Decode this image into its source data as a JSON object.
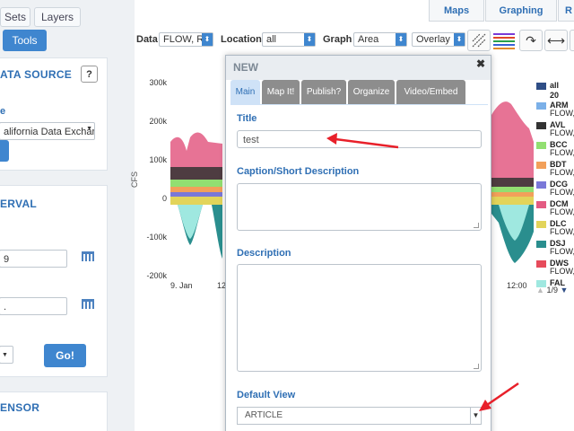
{
  "sidebar": {
    "tabs": [
      {
        "label": "Sets"
      },
      {
        "label": "Layers"
      }
    ],
    "tools_label": "Tools",
    "data_source": {
      "title": "ATA SOURCE",
      "help_label": "?",
      "field_label": "e",
      "source_value": "alifornia Data Exchar"
    },
    "interval": {
      "title": "ERVAL",
      "start_value": "9",
      "end_value": "."
    },
    "go_label": "Go!",
    "sensor_title": "ENSOR"
  },
  "top_tabs": [
    {
      "label": "Maps"
    },
    {
      "label": "Graphing"
    },
    {
      "label": "R"
    }
  ],
  "toolbar": {
    "data_label": "Data",
    "data_value": "FLOW, RI",
    "location_label": "Location",
    "location_value": "all",
    "graph_label": "Graph",
    "graph_value": "Area",
    "overlay_value": "Overlay"
  },
  "chart_data": {
    "type": "area",
    "y_tick_labels": [
      "300k",
      "200k",
      "100k",
      "0",
      "-100k",
      "-200k"
    ],
    "ylim": [
      -200000,
      300000
    ],
    "x_tick_labels": [
      "9. Jan",
      "12",
      "12:00"
    ],
    "ylabel": "CFS",
    "grid": false,
    "legend_position": "right",
    "series": [
      {
        "name": "all",
        "color": "#2f4e86"
      },
      {
        "name": "20",
        "color": "#7bb0e8"
      },
      {
        "name": "ARM",
        "color": "#333333"
      },
      {
        "name": "AVL",
        "color": "#92df71"
      },
      {
        "name": "BCC",
        "color": "#f2a05a"
      },
      {
        "name": "BDT",
        "color": "#7a78d8"
      },
      {
        "name": "DCG",
        "color": "#e35b82"
      },
      {
        "name": "DCM",
        "color": "#e2d45a"
      },
      {
        "name": "DLC",
        "color": "#2a8e8e"
      },
      {
        "name": "DSJ",
        "color": "#e64b5b"
      },
      {
        "name": "DWS",
        "color": "#9fe8e0"
      },
      {
        "name": "FAL",
        "color": "#cfe7f5"
      }
    ]
  },
  "legend": {
    "items": [
      {
        "name": "all",
        "sub": "",
        "color": "#2f4e86"
      },
      {
        "name": "20",
        "sub": "",
        "color": "#7bb0e8"
      },
      {
        "name": "ARM",
        "sub": "FLOW,",
        "color": "#333333"
      },
      {
        "name": "AVL",
        "sub": "FLOW,",
        "color": "#92df71"
      },
      {
        "name": "BCC",
        "sub": "FLOW,",
        "color": "#f2a05a"
      },
      {
        "name": "BDT",
        "sub": "FLOW,",
        "color": "#7a78d8"
      },
      {
        "name": "DCG",
        "sub": "FLOW,",
        "color": "#e35b82"
      },
      {
        "name": "DCM",
        "sub": "FLOW,",
        "color": "#e2d45a"
      },
      {
        "name": "DLC",
        "sub": "FLOW,",
        "color": "#2a8e8e"
      },
      {
        "name": "DSJ",
        "sub": "FLOW,",
        "color": "#e64b5b"
      },
      {
        "name": "DWS",
        "sub": "FLOW,",
        "color": "#9fe8e0"
      },
      {
        "name": "FAL",
        "sub": "",
        "color": "#cfe7f5"
      }
    ],
    "pager": "1/9"
  },
  "modal": {
    "title": "NEW",
    "close_label": "✖",
    "tabs": [
      {
        "label": "Main"
      },
      {
        "label": "Map It!"
      },
      {
        "label": "Publish?"
      },
      {
        "label": "Organize"
      },
      {
        "label": "Video/Embed"
      }
    ],
    "title_label": "Title",
    "title_value": "test",
    "caption_label": "Caption/Short Description",
    "description_label": "Description",
    "default_view_label": "Default View",
    "default_view_value": "ARTICLE"
  },
  "colors": {
    "accent": "#3f86cf",
    "annotation": "#e8202a"
  }
}
